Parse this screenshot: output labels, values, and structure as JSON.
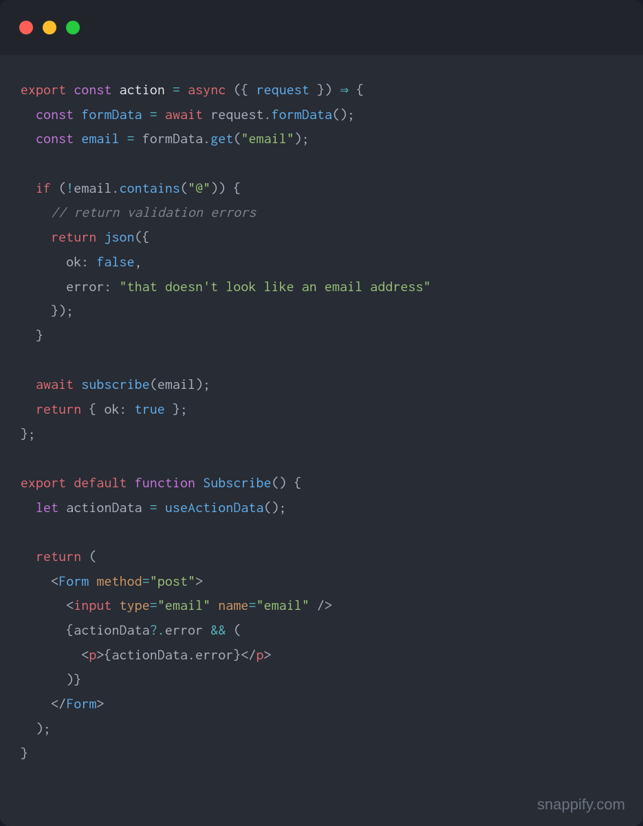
{
  "window": {
    "traffic_lights": [
      "red",
      "yellow",
      "green"
    ]
  },
  "code": {
    "tokens": [
      [
        {
          "t": "export",
          "c": "kw-red"
        },
        {
          "t": " ",
          "c": ""
        },
        {
          "t": "const",
          "c": "kw-purple"
        },
        {
          "t": " ",
          "c": ""
        },
        {
          "t": "action",
          "c": "kw-white"
        },
        {
          "t": " ",
          "c": ""
        },
        {
          "t": "=",
          "c": "kw-cyan"
        },
        {
          "t": " ",
          "c": ""
        },
        {
          "t": "async",
          "c": "kw-red"
        },
        {
          "t": " ({ ",
          "c": "kw-gray"
        },
        {
          "t": "request",
          "c": "kw-blue"
        },
        {
          "t": " }) ",
          "c": "kw-gray"
        },
        {
          "t": "⇒",
          "c": "kw-cyan"
        },
        {
          "t": " {",
          "c": "kw-gray"
        }
      ],
      [
        {
          "t": "  ",
          "c": ""
        },
        {
          "t": "const",
          "c": "kw-purple"
        },
        {
          "t": " ",
          "c": ""
        },
        {
          "t": "formData",
          "c": "kw-blue"
        },
        {
          "t": " ",
          "c": ""
        },
        {
          "t": "=",
          "c": "kw-cyan"
        },
        {
          "t": " ",
          "c": ""
        },
        {
          "t": "await",
          "c": "kw-red"
        },
        {
          "t": " request.",
          "c": "kw-gray"
        },
        {
          "t": "formData",
          "c": "kw-blue"
        },
        {
          "t": "();",
          "c": "kw-gray"
        }
      ],
      [
        {
          "t": "  ",
          "c": ""
        },
        {
          "t": "const",
          "c": "kw-purple"
        },
        {
          "t": " ",
          "c": ""
        },
        {
          "t": "email",
          "c": "kw-blue"
        },
        {
          "t": " ",
          "c": ""
        },
        {
          "t": "=",
          "c": "kw-cyan"
        },
        {
          "t": " formData.",
          "c": "kw-gray"
        },
        {
          "t": "get",
          "c": "kw-blue"
        },
        {
          "t": "(",
          "c": "kw-gray"
        },
        {
          "t": "\"email\"",
          "c": "kw-green"
        },
        {
          "t": ");",
          "c": "kw-gray"
        }
      ],
      [],
      [
        {
          "t": "  ",
          "c": ""
        },
        {
          "t": "if",
          "c": "kw-red"
        },
        {
          "t": " (",
          "c": "kw-gray"
        },
        {
          "t": "!",
          "c": "kw-cyan"
        },
        {
          "t": "email.",
          "c": "kw-gray"
        },
        {
          "t": "contains",
          "c": "kw-blue"
        },
        {
          "t": "(",
          "c": "kw-gray"
        },
        {
          "t": "\"@\"",
          "c": "kw-green"
        },
        {
          "t": ")) {",
          "c": "kw-gray"
        }
      ],
      [
        {
          "t": "    ",
          "c": ""
        },
        {
          "t": "// return validation errors",
          "c": "kw-comment"
        }
      ],
      [
        {
          "t": "    ",
          "c": ""
        },
        {
          "t": "return",
          "c": "kw-red"
        },
        {
          "t": " ",
          "c": ""
        },
        {
          "t": "json",
          "c": "kw-blue"
        },
        {
          "t": "({",
          "c": "kw-gray"
        }
      ],
      [
        {
          "t": "      ok: ",
          "c": "kw-gray"
        },
        {
          "t": "false",
          "c": "kw-blue"
        },
        {
          "t": ",",
          "c": "kw-gray"
        }
      ],
      [
        {
          "t": "      error: ",
          "c": "kw-gray"
        },
        {
          "t": "\"that doesn't look like an email address\"",
          "c": "kw-green"
        }
      ],
      [
        {
          "t": "    });",
          "c": "kw-gray"
        }
      ],
      [
        {
          "t": "  }",
          "c": "kw-gray"
        }
      ],
      [],
      [
        {
          "t": "  ",
          "c": ""
        },
        {
          "t": "await",
          "c": "kw-red"
        },
        {
          "t": " ",
          "c": ""
        },
        {
          "t": "subscribe",
          "c": "kw-blue"
        },
        {
          "t": "(email);",
          "c": "kw-gray"
        }
      ],
      [
        {
          "t": "  ",
          "c": ""
        },
        {
          "t": "return",
          "c": "kw-red"
        },
        {
          "t": " { ok: ",
          "c": "kw-gray"
        },
        {
          "t": "true",
          "c": "kw-blue"
        },
        {
          "t": " };",
          "c": "kw-gray"
        }
      ],
      [
        {
          "t": "};",
          "c": "kw-gray"
        }
      ],
      [],
      [
        {
          "t": "export",
          "c": "kw-red"
        },
        {
          "t": " ",
          "c": ""
        },
        {
          "t": "default",
          "c": "kw-red"
        },
        {
          "t": " ",
          "c": ""
        },
        {
          "t": "function",
          "c": "kw-purple"
        },
        {
          "t": " ",
          "c": ""
        },
        {
          "t": "Subscribe",
          "c": "kw-blue"
        },
        {
          "t": "() {",
          "c": "kw-gray"
        }
      ],
      [
        {
          "t": "  ",
          "c": ""
        },
        {
          "t": "let",
          "c": "kw-purple"
        },
        {
          "t": " actionData ",
          "c": "kw-gray"
        },
        {
          "t": "=",
          "c": "kw-cyan"
        },
        {
          "t": " ",
          "c": ""
        },
        {
          "t": "useActionData",
          "c": "kw-blue"
        },
        {
          "t": "();",
          "c": "kw-gray"
        }
      ],
      [],
      [
        {
          "t": "  ",
          "c": ""
        },
        {
          "t": "return",
          "c": "kw-red"
        },
        {
          "t": " (",
          "c": "kw-gray"
        }
      ],
      [
        {
          "t": "    <",
          "c": "kw-gray"
        },
        {
          "t": "Form",
          "c": "kw-blue"
        },
        {
          "t": " ",
          "c": ""
        },
        {
          "t": "method",
          "c": "kw-attr"
        },
        {
          "t": "=",
          "c": "kw-cyan"
        },
        {
          "t": "\"post\"",
          "c": "kw-green"
        },
        {
          "t": ">",
          "c": "kw-gray"
        }
      ],
      [
        {
          "t": "      <",
          "c": "kw-gray"
        },
        {
          "t": "input",
          "c": "kw-tag"
        },
        {
          "t": " ",
          "c": ""
        },
        {
          "t": "type",
          "c": "kw-attr"
        },
        {
          "t": "=",
          "c": "kw-cyan"
        },
        {
          "t": "\"email\"",
          "c": "kw-green"
        },
        {
          "t": " ",
          "c": ""
        },
        {
          "t": "name",
          "c": "kw-attr"
        },
        {
          "t": "=",
          "c": "kw-cyan"
        },
        {
          "t": "\"email\"",
          "c": "kw-green"
        },
        {
          "t": " />",
          "c": "kw-gray"
        }
      ],
      [
        {
          "t": "      {actionData",
          "c": "kw-gray"
        },
        {
          "t": "?.",
          "c": "kw-cyan"
        },
        {
          "t": "error ",
          "c": "kw-gray"
        },
        {
          "t": "&&",
          "c": "kw-cyan"
        },
        {
          "t": " (",
          "c": "kw-gray"
        }
      ],
      [
        {
          "t": "        <",
          "c": "kw-gray"
        },
        {
          "t": "p",
          "c": "kw-tag"
        },
        {
          "t": ">{actionData.error}</",
          "c": "kw-gray"
        },
        {
          "t": "p",
          "c": "kw-tag"
        },
        {
          "t": ">",
          "c": "kw-gray"
        }
      ],
      [
        {
          "t": "      )}",
          "c": "kw-gray"
        }
      ],
      [
        {
          "t": "    </",
          "c": "kw-gray"
        },
        {
          "t": "Form",
          "c": "kw-blue"
        },
        {
          "t": ">",
          "c": "kw-gray"
        }
      ],
      [
        {
          "t": "  );",
          "c": "kw-gray"
        }
      ],
      [
        {
          "t": "}",
          "c": "kw-gray"
        }
      ]
    ]
  },
  "watermark": "snappify.com"
}
